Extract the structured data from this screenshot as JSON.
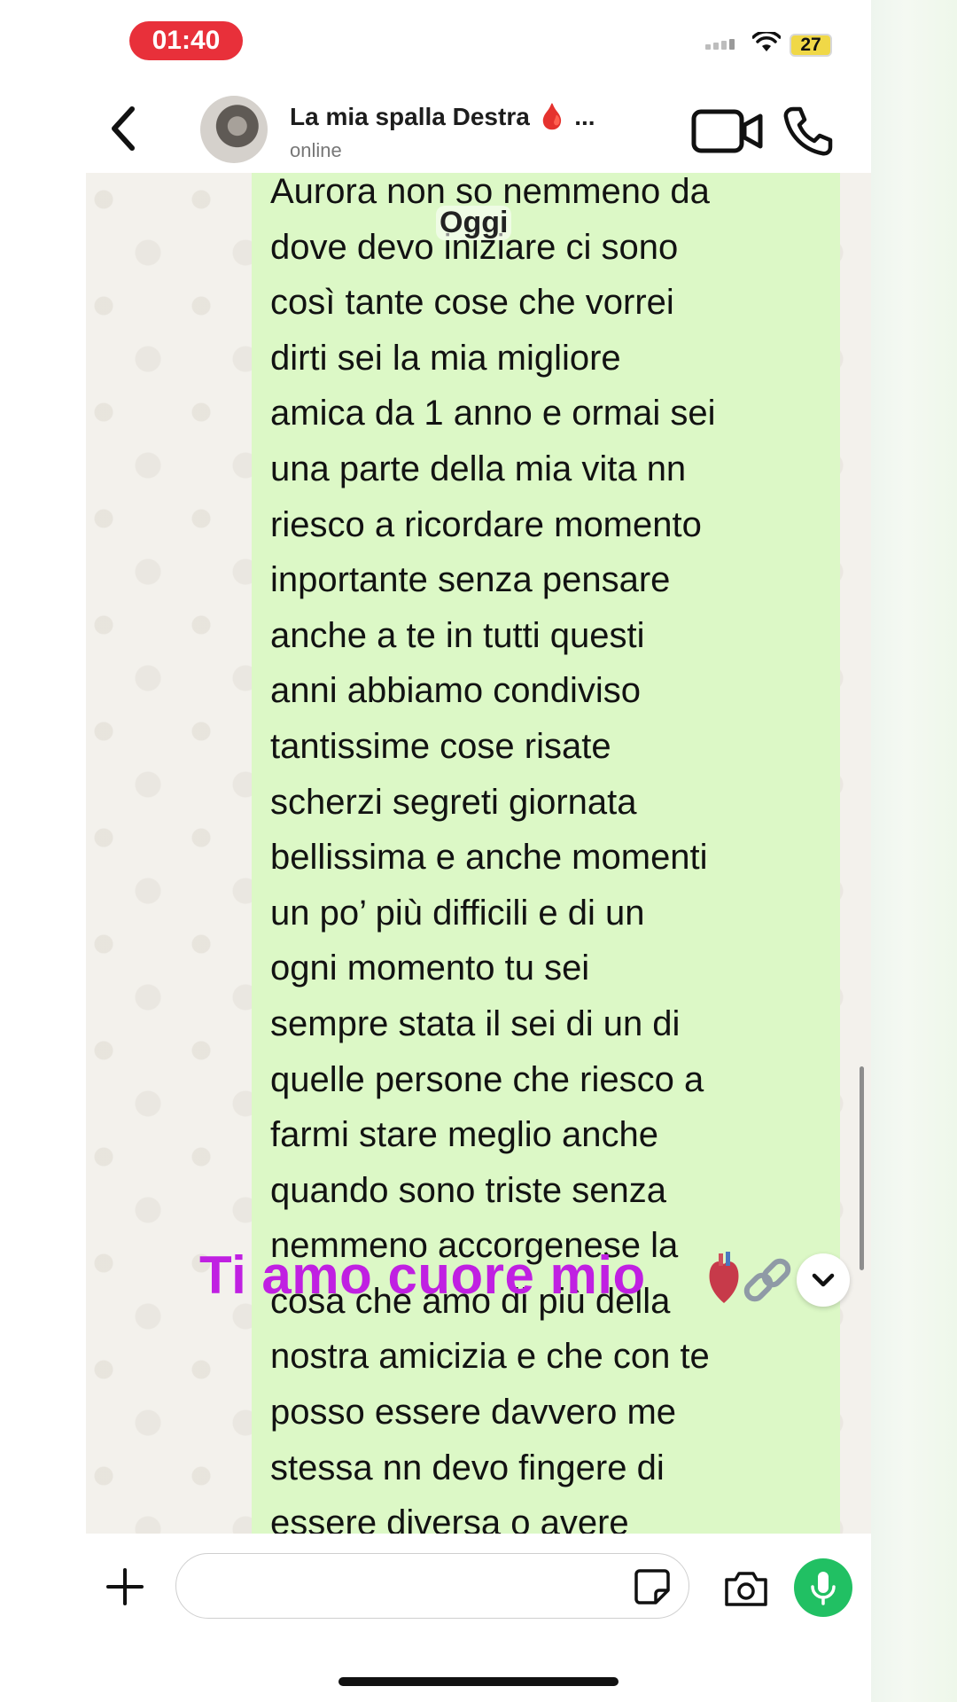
{
  "status_bar": {
    "time": "01:40",
    "battery": "27"
  },
  "header": {
    "contact_name": "La mia spalla Destra 🩸 ...",
    "contact_status": "online"
  },
  "chat": {
    "date_chip": "Oggi",
    "message_lines": [
      "Aurora non so nemmeno da",
      "dove devo iniziare ci sono",
      "così tante cose che vorrei",
      "dirti sei la mia migliore",
      "amica da 1 anno e ormai sei",
      "una parte della mia vita nn",
      "riesco a ricordare momento",
      "inportante senza pensare",
      "anche a te in tutti questi",
      "anni abbiamo condiviso",
      "tantissime cose risate",
      "scherzi segreti giornata",
      "bellissima e anche momenti",
      "un po’ più difficili e di un",
      "ogni momento tu sei",
      "sempre stata il sei di un di",
      "quelle persone che riesco a",
      "farmi stare meglio anche",
      "quando sono triste senza",
      "nemmeno accorgenese la",
      "cosa che amo di più della",
      "nostra amicizia e che con te",
      "posso essere davvero me",
      "stessa nn devo fingere di",
      "essere diversa o avere"
    ],
    "overlay_caption": "Ti amo cuore mio"
  },
  "colors": {
    "bubble": "#dcf8c6",
    "time_pill": "#e8303a",
    "mic": "#21c063",
    "caption": "#c020e2"
  },
  "icons": {
    "back": "chevron-left-icon",
    "video": "video-call-icon",
    "call": "phone-icon",
    "plus": "plus-icon",
    "sticker": "sticker-icon",
    "camera": "camera-icon",
    "mic": "microphone-icon",
    "scroll_down": "chevron-down-icon"
  }
}
